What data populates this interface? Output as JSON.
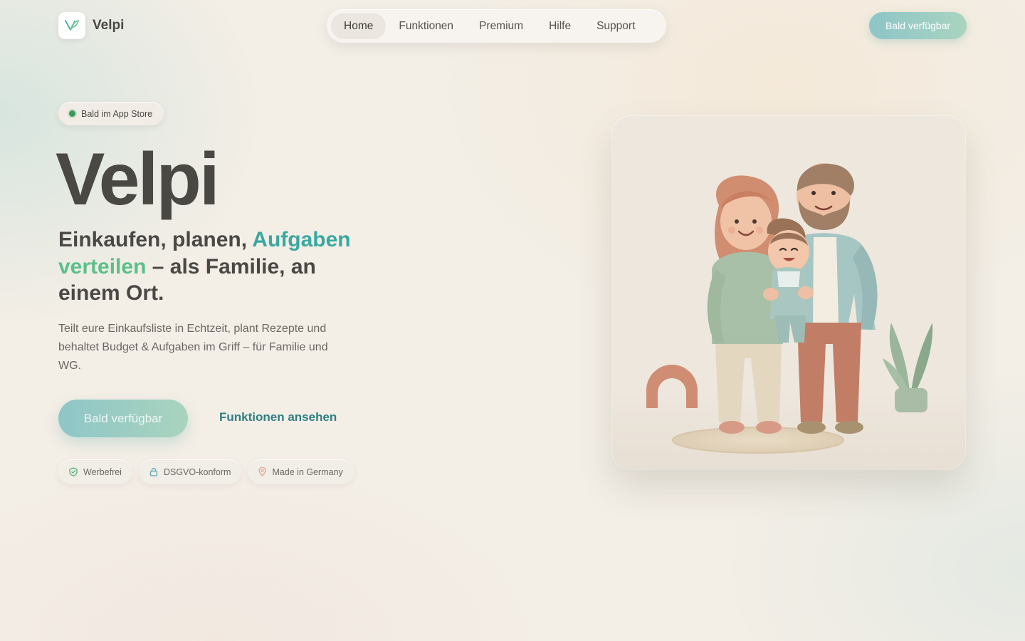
{
  "brand": {
    "name": "Velpi",
    "logo_icon": "velpi-logo-icon"
  },
  "nav": {
    "items": [
      {
        "label": "Home",
        "active": true
      },
      {
        "label": "Funktionen",
        "active": false
      },
      {
        "label": "Premium",
        "active": false
      },
      {
        "label": "Hilfe",
        "active": false
      },
      {
        "label": "Support",
        "active": false
      }
    ]
  },
  "header": {
    "cta_label": "Bald verfügbar"
  },
  "hero": {
    "badge": "Bald im App Store",
    "title": "Velpi",
    "subtitle": {
      "part1": "Einkaufen, planen, ",
      "highlight1": "Aufgaben",
      "highlight2": "verteilen",
      "part2": " – als Familie, an einem Ort."
    },
    "description": "Teilt eure Einkaufsliste in Echtzeit, plant Rezepte und behaltet Budget & Aufgaben im Griff – für Familie und WG.",
    "primary_cta": "Bald verfügbar",
    "secondary_cta": "Funktionen ansehen",
    "chips": [
      {
        "label": "Werbefrei",
        "icon": "shield-check-icon"
      },
      {
        "label": "DSGVO-konform",
        "icon": "lock-icon"
      },
      {
        "label": "Made in Germany",
        "icon": "location-pin-icon"
      }
    ],
    "image_alt": "family-illustration"
  },
  "colors": {
    "accent_teal": "#3aa8a0",
    "accent_green": "#5bbf88",
    "link": "#2d7f82",
    "status_dot": "#3a9a5a"
  }
}
